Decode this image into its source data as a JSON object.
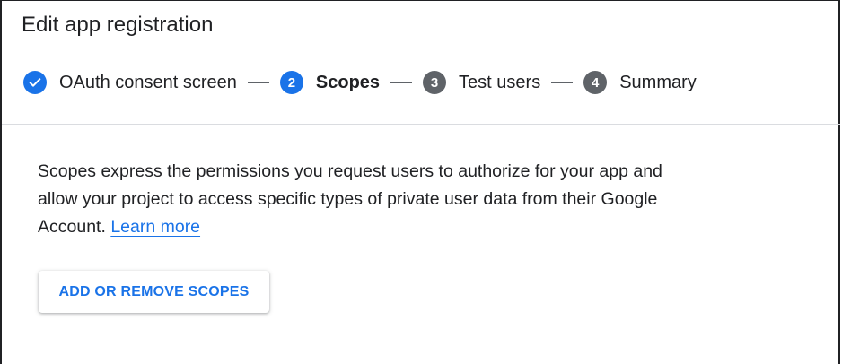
{
  "page": {
    "title": "Edit app registration"
  },
  "stepper": {
    "steps": [
      {
        "number": "",
        "label": "OAuth consent screen",
        "state": "done",
        "icon": "check-icon"
      },
      {
        "number": "2",
        "label": "Scopes",
        "state": "active"
      },
      {
        "number": "3",
        "label": "Test users",
        "state": "inactive"
      },
      {
        "number": "4",
        "label": "Summary",
        "state": "inactive"
      }
    ]
  },
  "content": {
    "description": "Scopes express the permissions you request users to authorize for your app and allow your project to access specific types of private user data from their Google Account.",
    "learn_more": "Learn more",
    "add_scopes_button": "ADD OR REMOVE SCOPES"
  },
  "colors": {
    "accent": "#1a73e8",
    "inactive_step": "#5f6368",
    "text": "#202124",
    "divider": "#dadce0"
  }
}
